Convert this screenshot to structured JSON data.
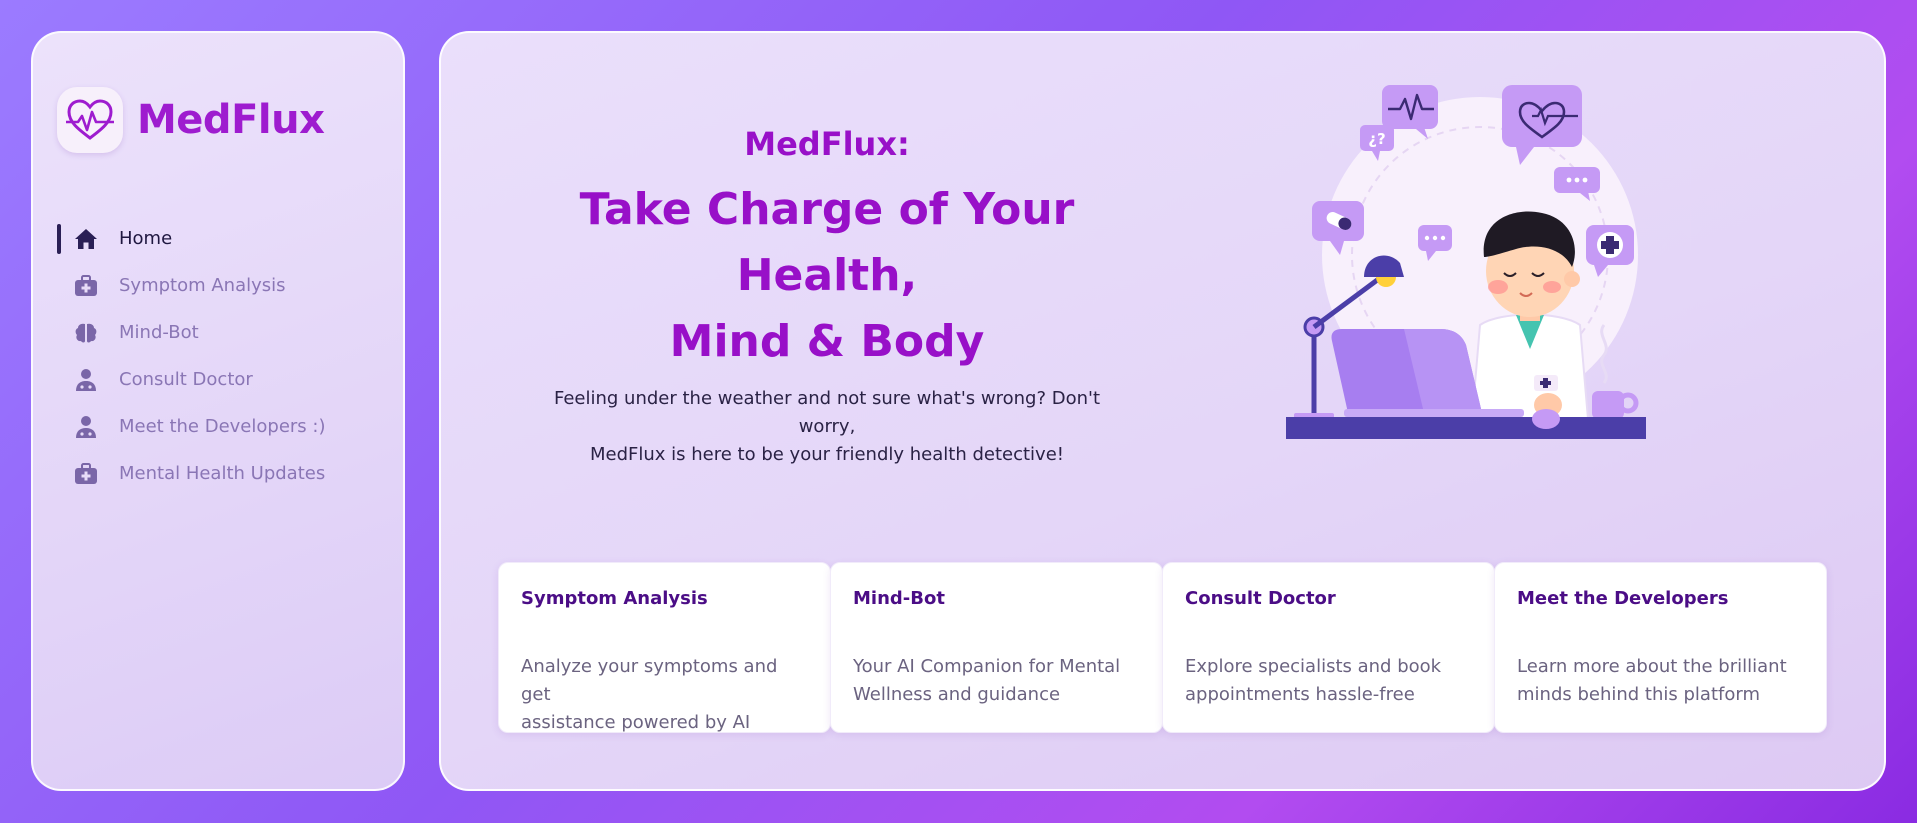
{
  "app": {
    "name": "MedFlux"
  },
  "colors": {
    "accent": "#9810c8",
    "nav_active": "#1f1740",
    "nav_inactive": "#8a76b5",
    "card_title": "#4b0d86"
  },
  "sidebar": {
    "items": [
      {
        "label": "Home",
        "icon": "home-icon",
        "active": true
      },
      {
        "label": "Symptom Analysis",
        "icon": "medical-kit-icon",
        "active": false
      },
      {
        "label": "Mind-Bot",
        "icon": "brain-icon",
        "active": false
      },
      {
        "label": "Consult Doctor",
        "icon": "doctor-icon",
        "active": false
      },
      {
        "label": "Meet the Developers :)",
        "icon": "doctor-icon",
        "active": false
      },
      {
        "label": "Mental Health Updates",
        "icon": "medical-kit-icon",
        "active": false
      }
    ]
  },
  "hero": {
    "kicker": "MedFlux:",
    "title_line1": "Take Charge of Your Health,",
    "title_line2": "Mind & Body",
    "desc_line1": "Feeling under the weather and not sure what's wrong? Don't worry,",
    "desc_line2": "MedFlux is here to be your friendly health detective!",
    "illustration": "doctor-at-laptop-illustration"
  },
  "cards": [
    {
      "title": "Symptom Analysis",
      "line1": "Analyze your symptoms and get",
      "line2": "assistance powered by AI"
    },
    {
      "title": "Mind-Bot",
      "line1": "Your AI Companion for Mental",
      "line2": "Wellness and guidance"
    },
    {
      "title": "Consult Doctor",
      "line1": "Explore specialists and book",
      "line2": "appointments hassle-free"
    },
    {
      "title": "Meet the Developers",
      "line1": "Learn more about the brilliant",
      "line2": "minds behind this platform"
    }
  ]
}
